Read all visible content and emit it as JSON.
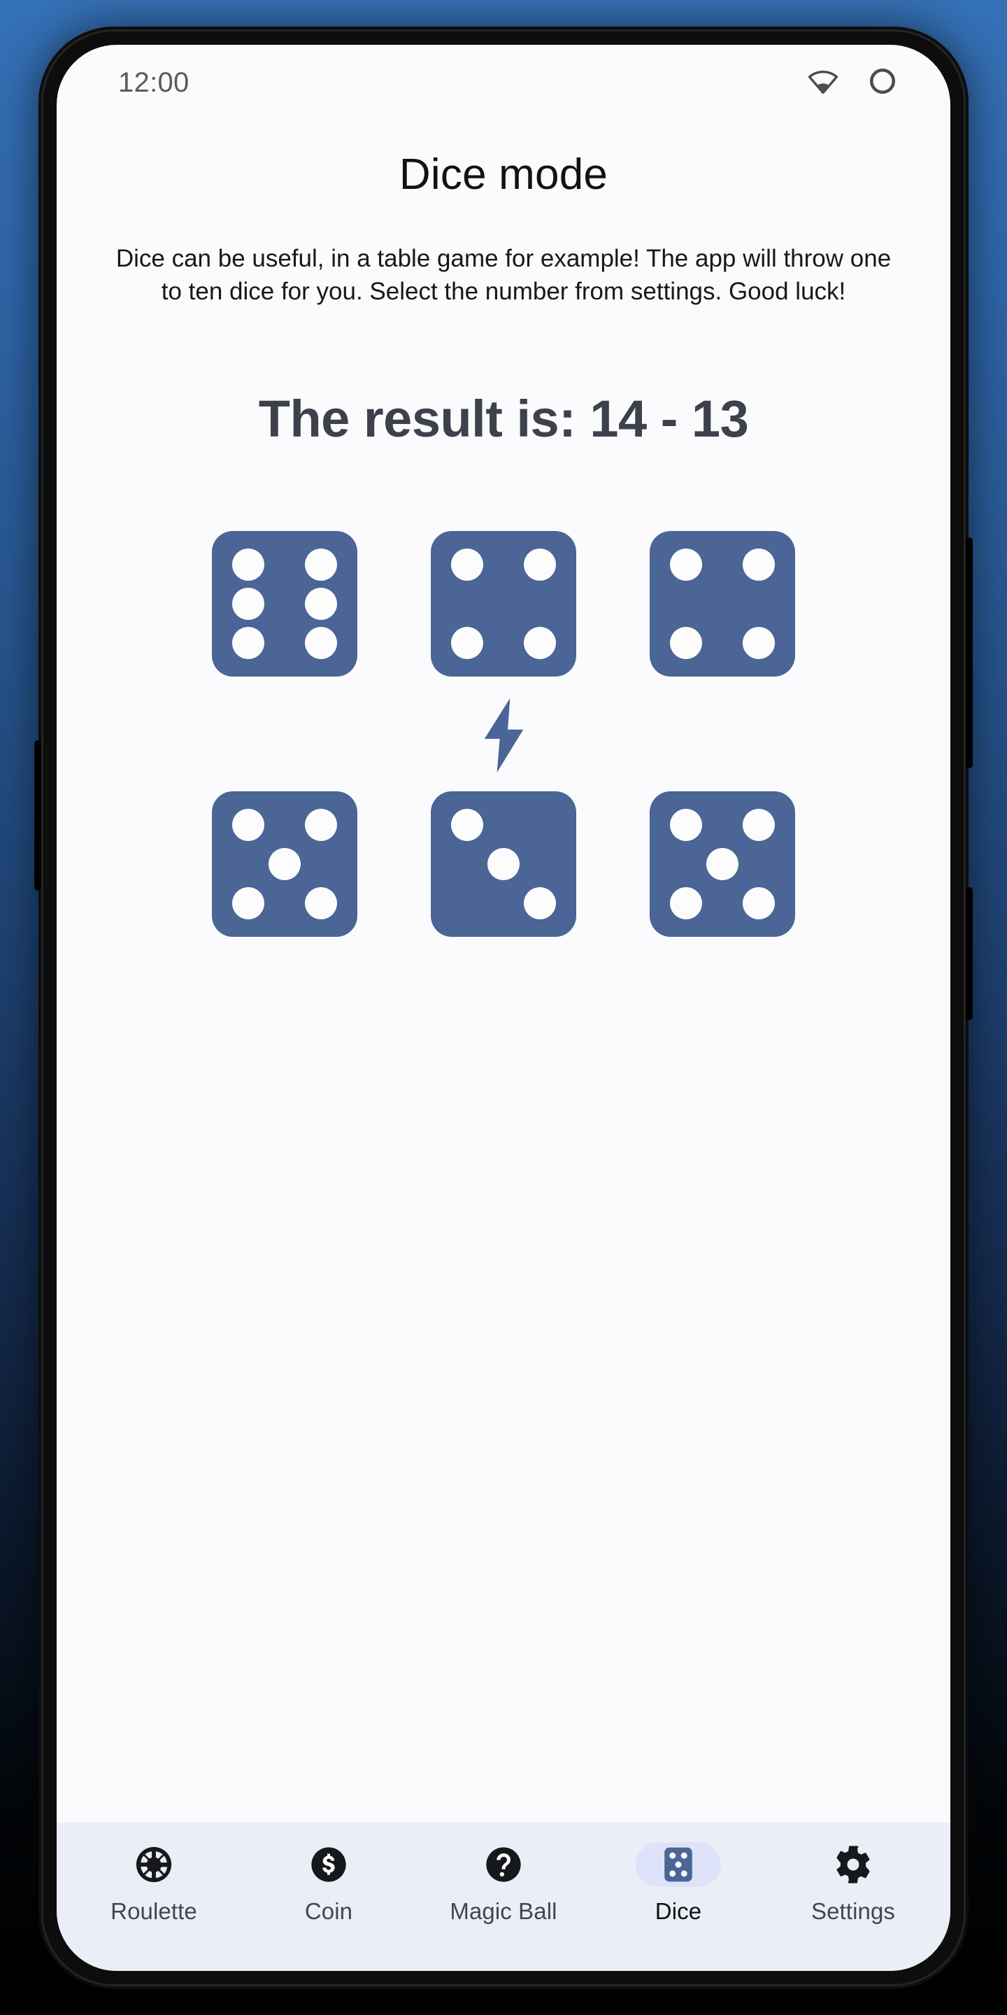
{
  "status_bar": {
    "time": "12:00",
    "icons": [
      "wifi-icon",
      "circle-icon"
    ]
  },
  "screen": {
    "title": "Dice mode",
    "description": "Dice can be useful, in a table game for example! The app will throw one to ten dice for you. Select the number from settings. Good luck!",
    "result": "The result is: 14 - 13"
  },
  "dice": {
    "separator_icon": "lightning-bolt-icon",
    "row1_total": 14,
    "row2_total": 13,
    "row1": [
      6,
      4,
      4
    ],
    "row2": [
      5,
      3,
      5
    ]
  },
  "bottom_nav": {
    "items": [
      {
        "label": "Roulette",
        "icon": "roulette-wheel-icon",
        "active": false
      },
      {
        "label": "Coin",
        "icon": "coin-dollar-icon",
        "active": false
      },
      {
        "label": "Magic Ball",
        "icon": "question-mark-icon",
        "active": false
      },
      {
        "label": "Dice",
        "icon": "dice-icon",
        "active": true
      },
      {
        "label": "Settings",
        "icon": "gear-icon",
        "active": false
      }
    ]
  },
  "colors": {
    "dice_blue": "#4a6596",
    "pip_white": "#fcfcfd",
    "nav_background": "#eceef7",
    "nav_active_pill": "#dee3f9",
    "screen_background": "#fbfbfd",
    "result_text": "#3d414b",
    "backdrop_top": "#3571b6",
    "backdrop_bottom": "#000000"
  }
}
